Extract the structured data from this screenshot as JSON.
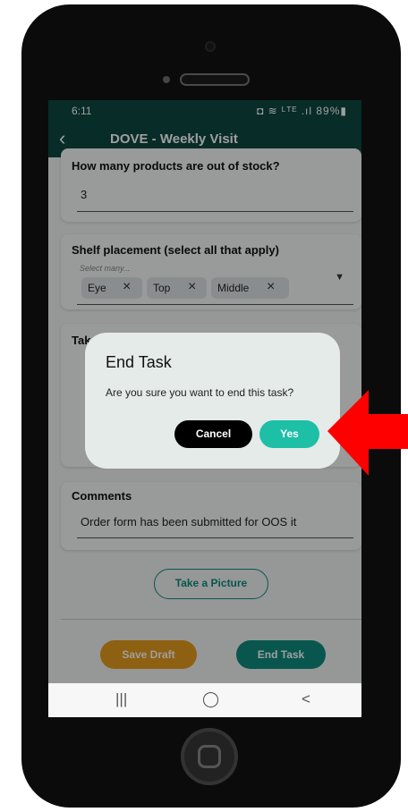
{
  "status_bar": {
    "time": "6:11",
    "icons": "◘ ≋ ᴸᵀᴱ .ıl 89%▮"
  },
  "app_bar": {
    "back_icon": "chevron-left-icon",
    "title": "DOVE - Weekly Visit"
  },
  "form": {
    "oos_question": {
      "label": "How many products are out of stock?",
      "value": "3"
    },
    "shelf_placement": {
      "label": "Shelf placement (select all that apply)",
      "placeholder": "Select many...",
      "chips": [
        "Eye",
        "Top",
        "Middle"
      ]
    },
    "take_card_label": "Tak",
    "comments": {
      "label": "Comments",
      "value": "Order form has been submitted for OOS it"
    }
  },
  "buttons": {
    "take_picture": "Take a Picture",
    "save_draft": "Save Draft",
    "end_task": "End Task"
  },
  "dialog": {
    "title": "End Task",
    "message": "Are you sure you want to end this task?",
    "cancel": "Cancel",
    "yes": "Yes"
  },
  "navbar": {
    "recents": "|||",
    "home": "◯",
    "back": "<"
  },
  "colors": {
    "header": "#0e4840",
    "accent": "#0e8c7e",
    "yes": "#1dbfa7",
    "draft": "#e69b1c",
    "arrow": "#ff0000"
  }
}
